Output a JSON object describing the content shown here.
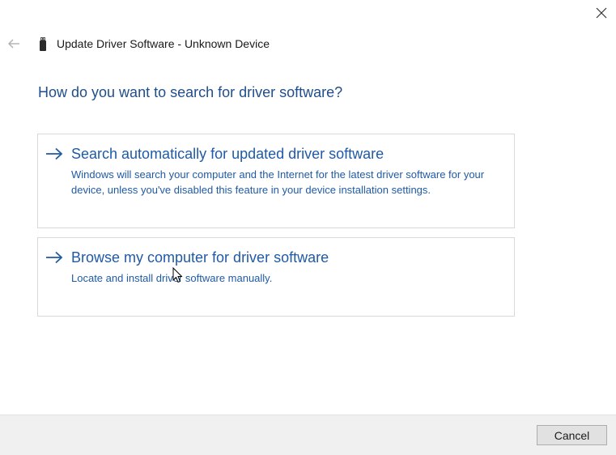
{
  "window": {
    "title": "Update Driver Software - Unknown Device",
    "close_icon": "close-icon",
    "back_icon": "back-arrow-icon",
    "device_icon": "usb-device-icon"
  },
  "heading": "How do you want to search for driver software?",
  "options": [
    {
      "icon": "arrow-right-icon",
      "title": "Search automatically for updated driver software",
      "description": "Windows will search your computer and the Internet for the latest driver software for your device, unless you've disabled this feature in your device installation settings."
    },
    {
      "icon": "arrow-right-icon",
      "title": "Browse my computer for driver software",
      "description": "Locate and install driver software manually."
    }
  ],
  "footer": {
    "cancel_label": "Cancel"
  },
  "colors": {
    "accent": "#1f5aa6",
    "heading": "#1f4e8c",
    "footer_bg": "#f0f0f0"
  }
}
